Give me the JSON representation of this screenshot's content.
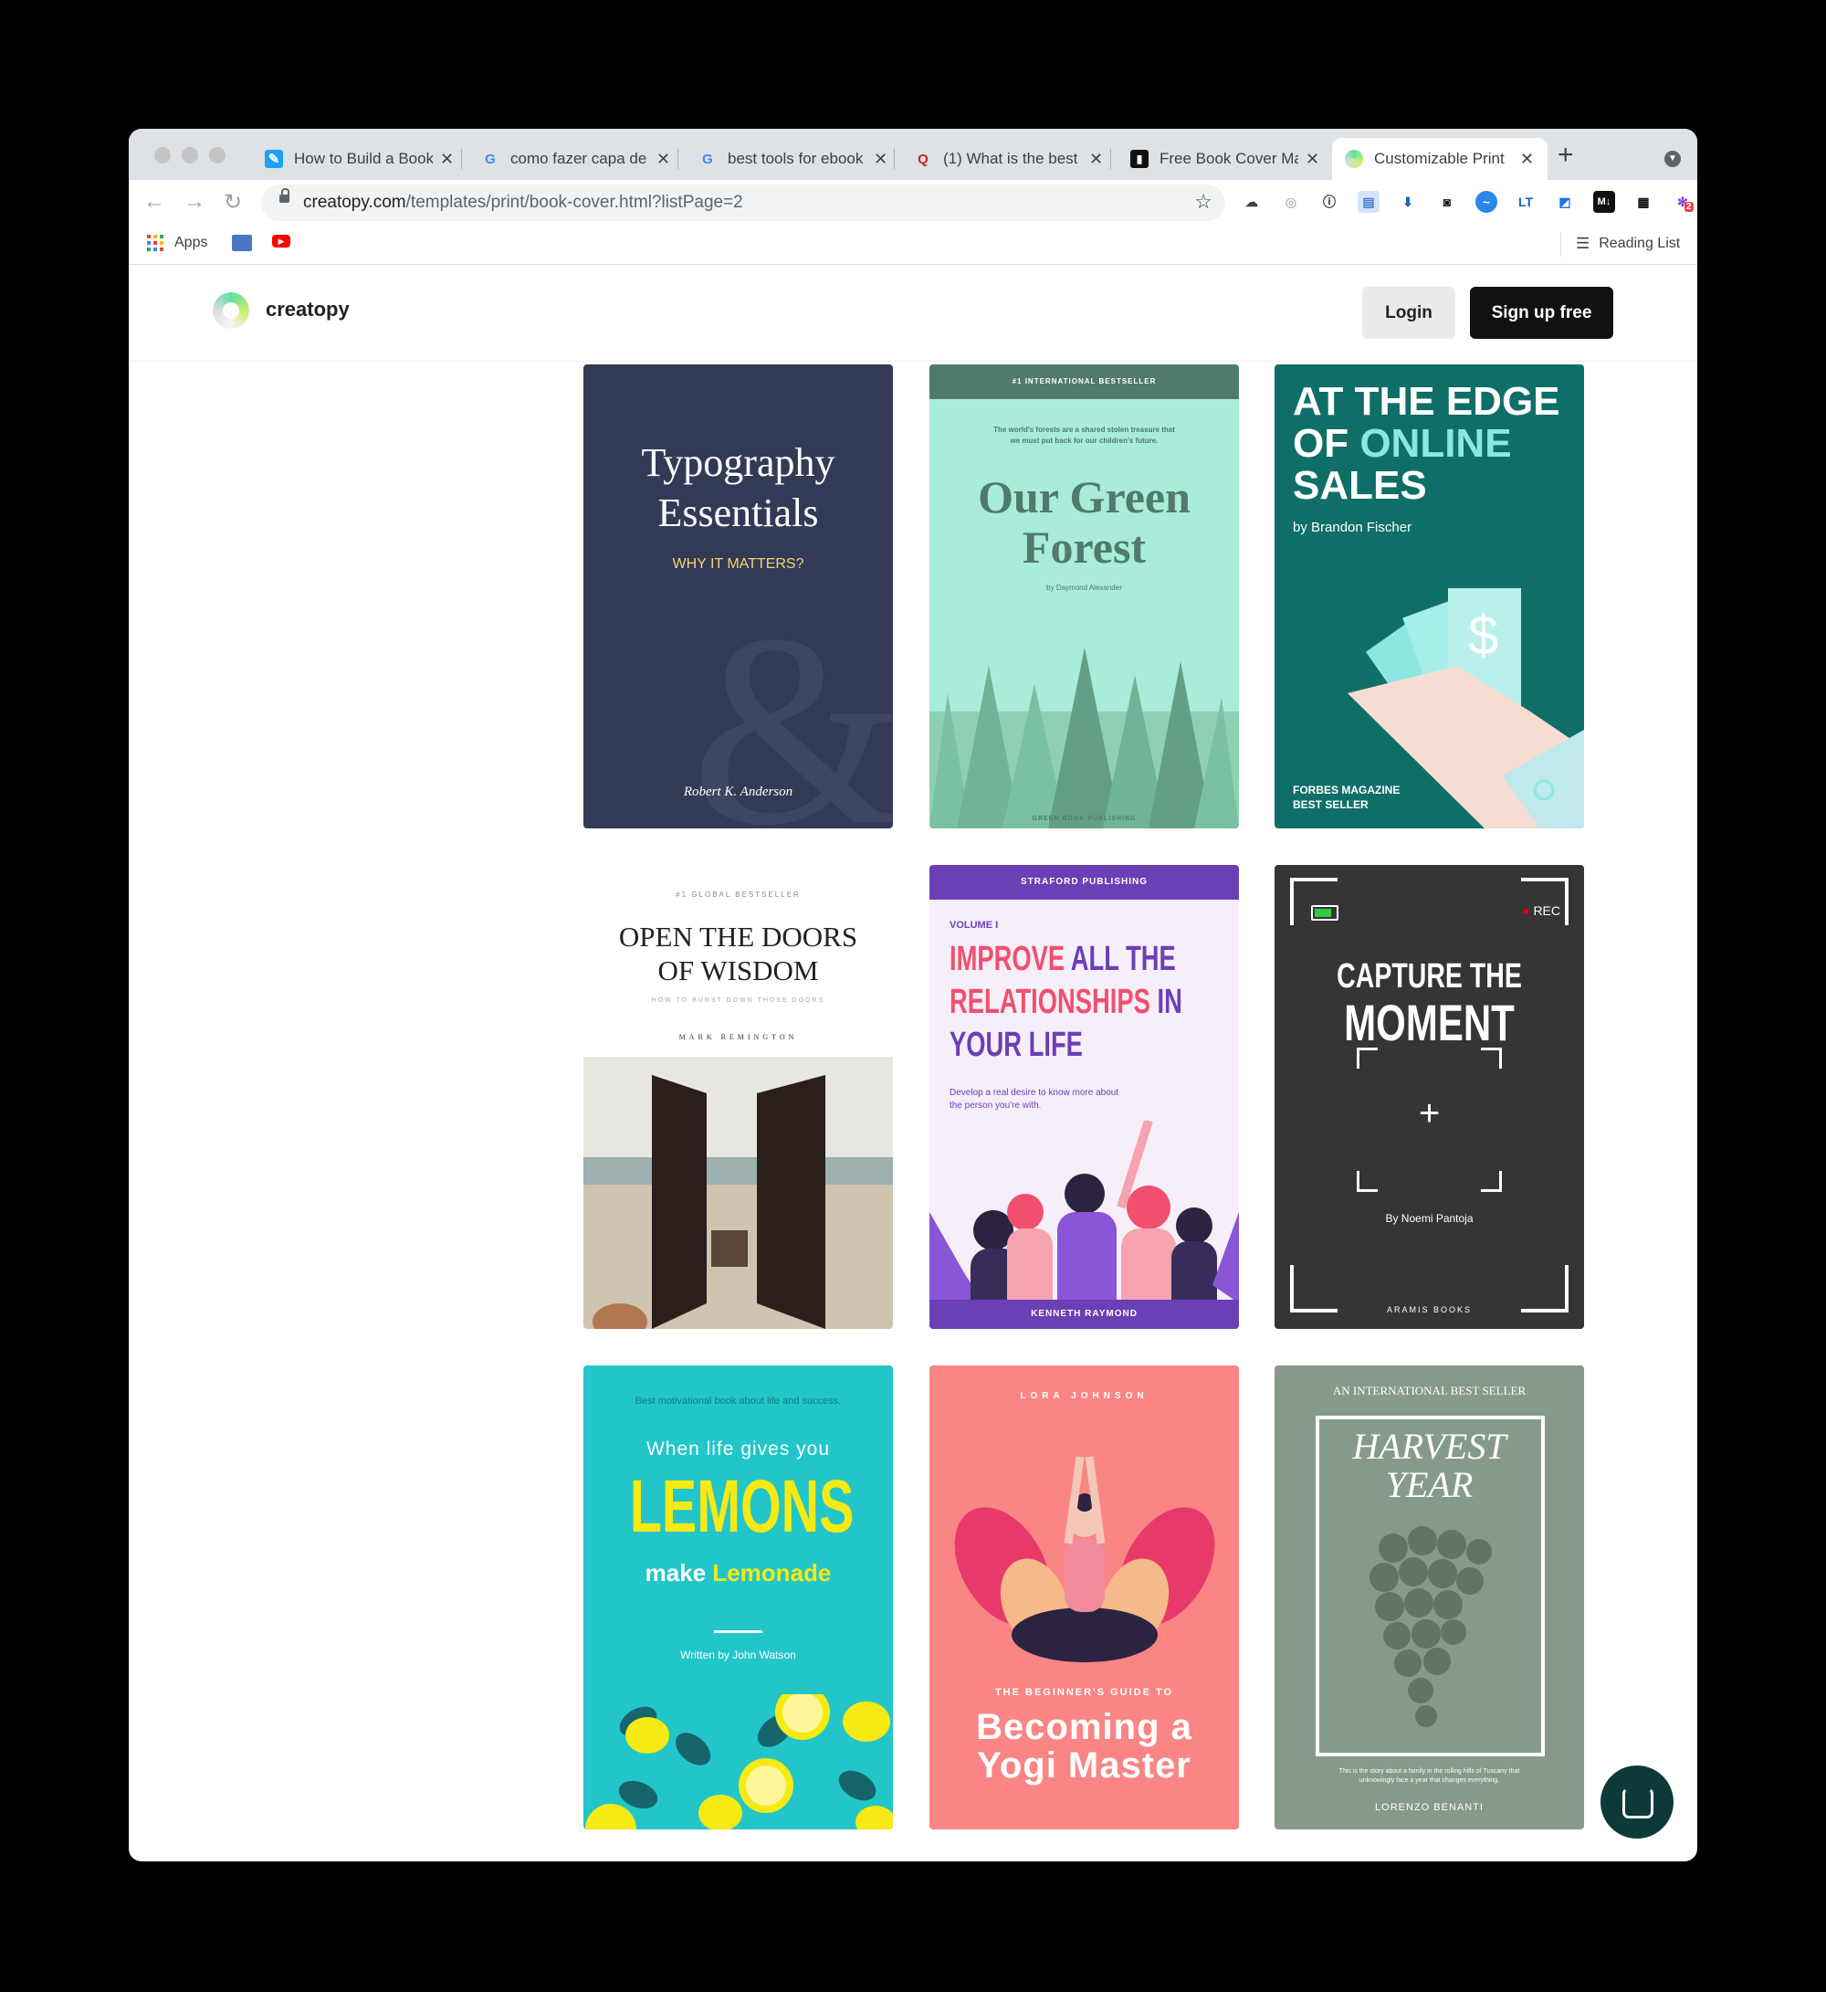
{
  "browser": {
    "tabs": [
      {
        "title": "How to Build a Book",
        "icon": "bookmark-icon"
      },
      {
        "title": "como fazer capa de",
        "icon": "google-icon"
      },
      {
        "title": "best tools for ebook",
        "icon": "google-icon"
      },
      {
        "title": "(1) What is the best",
        "icon": "quora-icon"
      },
      {
        "title": "Free Book Cover Ma",
        "icon": "site-icon"
      },
      {
        "title": "Customizable Print",
        "icon": "creatopy-icon"
      }
    ],
    "url_host": "creatopy.com",
    "url_path": "/templates/print/book-cover.html?listPage=2",
    "bookmarks": {
      "apps_label": "Apps",
      "reading_list_label": "Reading List"
    },
    "extension_badge": "2"
  },
  "site": {
    "logo_text": "creatopy",
    "login_label": "Login",
    "signup_label": "Sign up free"
  },
  "cards": {
    "c1": {
      "title_line1": "Typography",
      "title_line2": "Essentials",
      "subtitle": "WHY IT MATTERS?",
      "ampersand": "&",
      "author": "Robert K. Anderson"
    },
    "c2": {
      "top_banner": "#1 INTERNATIONAL BESTSELLER",
      "tagline_line1": "The world's forests are a shared stolen treasure that",
      "tagline_line2": "we must put back for our children's future.",
      "title_line1": "Our Green",
      "title_line2": "Forest",
      "author": "by Daymond Alexander",
      "publisher": "GREEN BOOK PUBLISHING"
    },
    "c3": {
      "title_line1": "AT THE EDGE",
      "title_of": "OF ",
      "title_online": "ONLINE",
      "title_line3": "SALES",
      "author": "by Brandon Fischer",
      "bottom_line1": "FORBES MAGAZINE",
      "bottom_line2": "BEST SELLER",
      "symbol": "$"
    },
    "c4": {
      "top": "#1 GLOBAL BESTSELLER",
      "title_line1": "OPEN THE DOORS",
      "title_line2": "OF WISDOM",
      "subtitle": "HOW TO BURST DOWN THOSE DOORS",
      "author": "MARK REMINGTON"
    },
    "c5": {
      "publisher": "STRAFORD PUBLISHING",
      "volume": "VOLUME I",
      "title_line1a": "IMPROVE ",
      "title_line1b": "ALL THE",
      "title_line2a": "RELATIONSHIPS ",
      "title_line2b": "IN",
      "title_line3": "YOUR LIFE",
      "desc_line1": "Develop a real desire to know more about",
      "desc_line2": "the person you're with.",
      "author": "KENNETH RAYMOND"
    },
    "c6": {
      "rec": "REC",
      "title_line1": "CAPTURE THE",
      "title_line2": "MOMENT",
      "crosshair": "+",
      "author": "By Noemi Pantoja",
      "publisher": "ARAMIS BOOKS"
    },
    "c7": {
      "top": "Best motivational book about life and success.",
      "line1": "When life gives you",
      "title": "LEMONS",
      "make": "make ",
      "lemonade": "Lemonade",
      "author": "Written by John Watson"
    },
    "c8": {
      "author": "LORA JOHNSON",
      "guide": "THE BEGINNER'S GUIDE TO",
      "title_line1": "Becoming a",
      "title_line2": "Yogi Master"
    },
    "c9": {
      "top": "AN INTERNATIONAL BEST SELLER",
      "title_line1": "HARVEST",
      "title_line2": "YEAR",
      "desc_line1": "This is the story about a family in the rolling hills of Tuscany that",
      "desc_line2": "unknowingly face a year that changes everything.",
      "author": "LORENZO BENANTI"
    }
  },
  "colors": {
    "typography_bg": "#333a55",
    "forest_bg": "#a8ecd9",
    "sales_bg": "#0f6f68",
    "relationships_accent": "#6b3fb5",
    "lemons_bg": "#22c6c9",
    "yogi_bg": "#fa8585",
    "harvest_bg": "#869a8b",
    "chat_button": "#0d3a38"
  }
}
